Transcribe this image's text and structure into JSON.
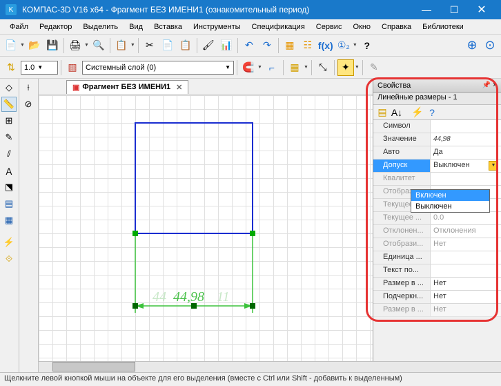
{
  "titlebar": {
    "app_icon": "K",
    "title": "КОМПАС-3D V16  x64 - Фрагмент БЕЗ ИМЕНИ1 (ознакомительный период)"
  },
  "menu": {
    "file": "Файл",
    "editor": "Редактор",
    "select": "Выделить",
    "view": "Вид",
    "insert": "Вставка",
    "tools": "Инструменты",
    "spec": "Спецификация",
    "service": "Сервис",
    "window": "Окно",
    "help": "Справка",
    "libs": "Библиотеки"
  },
  "toolbar2": {
    "scale": "1.0",
    "layer": "Системный слой (0)"
  },
  "doc_tab": {
    "name": "Фрагмент БЕЗ ИМЕНИ1"
  },
  "dimension": {
    "value": "44,98"
  },
  "props": {
    "title": "Свойства",
    "subtitle": "Линейные размеры - 1",
    "rows": {
      "symbol": {
        "k": "Символ",
        "v": ""
      },
      "value": {
        "k": "Значение",
        "v": "44,98"
      },
      "auto": {
        "k": "Авто",
        "v": "Да"
      },
      "tolerance": {
        "k": "Допуск",
        "v": "Выключен"
      },
      "kvalitet": {
        "k": "Квалитет",
        "v": ""
      },
      "display1": {
        "k": "Отобрази...",
        "v": ""
      },
      "curr1": {
        "k": "Текущее ...",
        "v": "0.0"
      },
      "curr2": {
        "k": "Текущее ...",
        "v": "0.0"
      },
      "deviation": {
        "k": "Отклонен...",
        "v": "Отклонения"
      },
      "display2": {
        "k": "Отобрази...",
        "v": "Нет"
      },
      "unit": {
        "k": "Единица ...",
        "v": ""
      },
      "textafter": {
        "k": "Текст по...",
        "v": ""
      },
      "sizein": {
        "k": "Размер в ...",
        "v": "Нет"
      },
      "underline": {
        "k": "Подчеркн...",
        "v": "Нет"
      },
      "last": {
        "k": "Размер в ...",
        "v": "Нет"
      }
    },
    "dropdown": {
      "on": "Включен",
      "off": "Выключен"
    }
  },
  "status": {
    "text": "Щелкните левой кнопкой мыши на объекте для его выделения (вместе с Ctrl или Shift - добавить к выделенным)"
  }
}
